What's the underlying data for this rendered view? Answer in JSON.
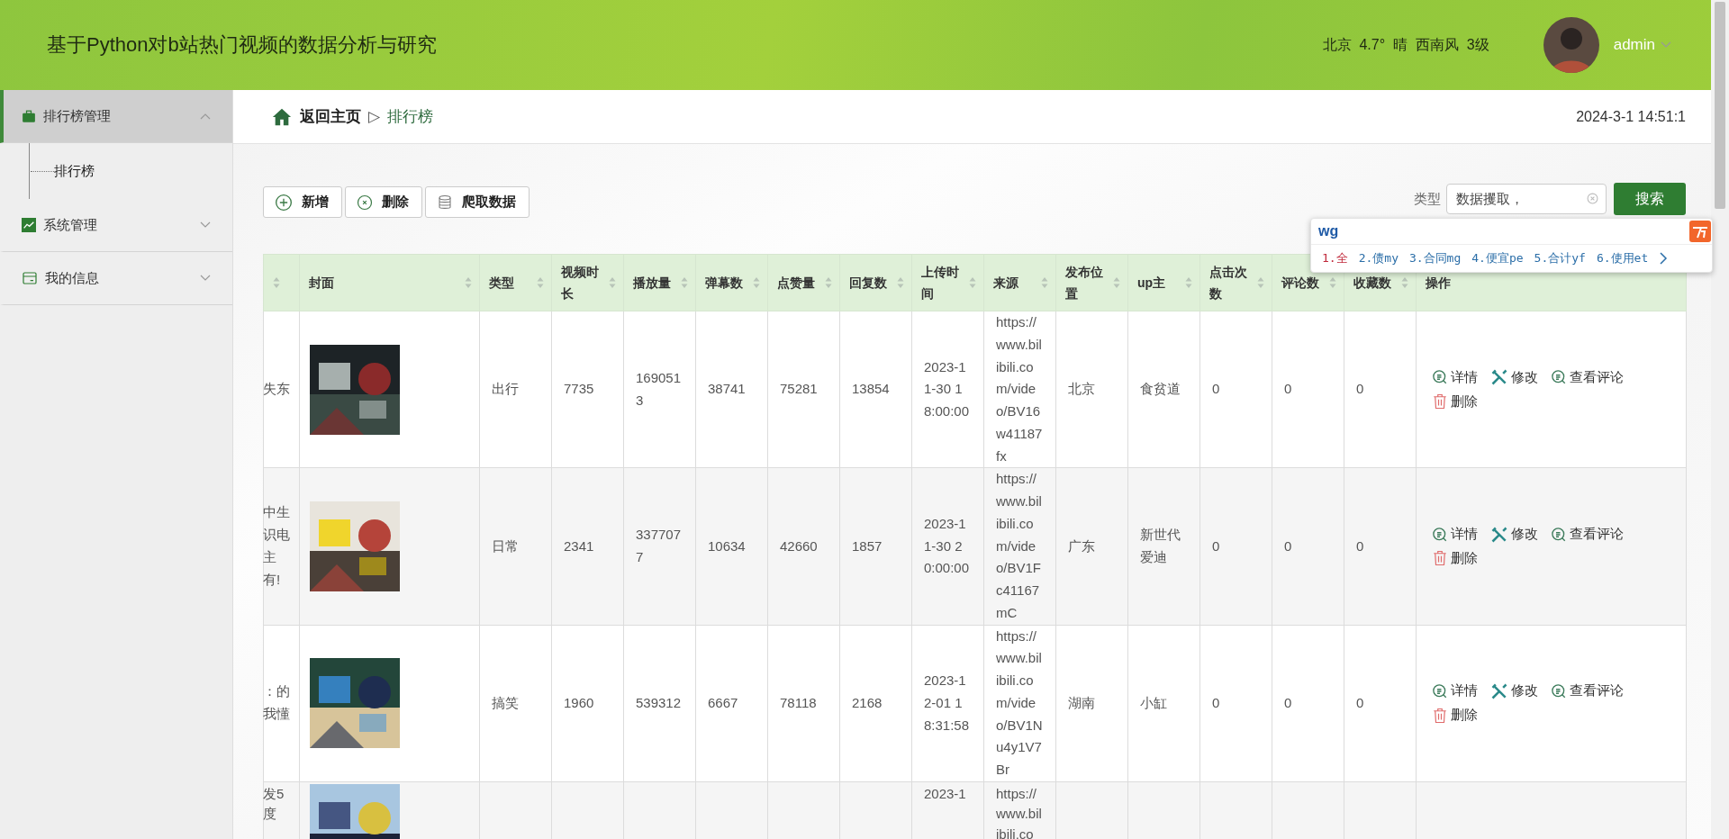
{
  "header": {
    "title": "基于Python对b站热门视频的数据分析与研究",
    "weather": "北京  4.7°  晴  西南风  3级",
    "user": "admin"
  },
  "sidebar": {
    "items": [
      {
        "label": "排行榜管理",
        "selected": true,
        "expanded": true,
        "children": [
          {
            "label": "排行榜",
            "selected": false
          }
        ]
      },
      {
        "label": "系统管理",
        "selected": false,
        "expanded": false
      },
      {
        "label": "我的信息",
        "selected": false,
        "expanded": false
      }
    ]
  },
  "breadcrumb": {
    "home": "返回主页",
    "separator": "▷",
    "current": "排行榜",
    "datetime": "2024-3-1 14:51:1"
  },
  "toolbar": {
    "buttons": [
      {
        "label": "新增",
        "kind": "add"
      },
      {
        "label": "删除",
        "kind": "remove"
      },
      {
        "label": "爬取数据",
        "kind": "crawl"
      }
    ]
  },
  "search": {
    "label": "类型",
    "value": "数据攫取，",
    "button": "搜索"
  },
  "ime_popup": {
    "input": "wg",
    "candidates": [
      {
        "label": "1.全",
        "selected": true
      },
      {
        "label": "2.债my",
        "selected": false
      },
      {
        "label": "3.合同mg",
        "selected": false
      },
      {
        "label": "4.便宜pe",
        "selected": false
      },
      {
        "label": "5.合计yf",
        "selected": false
      },
      {
        "label": "6.使用et",
        "selected": false
      }
    ]
  },
  "table": {
    "columns": [
      "封面",
      "类型",
      "视频时长",
      "播放量",
      "弹幕数",
      "点赞量",
      "回复数",
      "上传时间",
      "来源",
      "发布位置",
      "up主",
      "点击次数",
      "评论数",
      "收藏数",
      "操作"
    ],
    "rows": [
      {
        "column_1": "失东",
        "type": "出行",
        "duration": "7735",
        "plays": "1690513",
        "danmaku": "38741",
        "likes": "75281",
        "replies": "13854",
        "upload_time": "2023-11-30 18:00:00",
        "source": "https://www.bilibili.com/video/BV16w41187fx",
        "location": "北京",
        "uploader": "食贫道",
        "clicks": "0",
        "comments": "0",
        "favorites": "0",
        "actions": [
          {
            "label": "详情",
            "kind": "detail"
          },
          {
            "label": "修改",
            "kind": "edit"
          },
          {
            "label": "查看评论",
            "kind": "comments"
          },
          {
            "label": "删除",
            "kind": "delete"
          }
        ]
      },
      {
        "column_1": "中生识电主有!",
        "type": "日常",
        "duration": "2341",
        "plays": "3377077",
        "danmaku": "10634",
        "likes": "42660",
        "replies": "1857",
        "upload_time": "2023-11-30 20:00:00",
        "source": "https://www.bilibili.com/video/BV1Fc41167mC",
        "location": "广东",
        "uploader": "新世代爱迪",
        "clicks": "0",
        "comments": "0",
        "favorites": "0",
        "actions": [
          {
            "label": "详情",
            "kind": "detail"
          },
          {
            "label": "修改",
            "kind": "edit"
          },
          {
            "label": "查看评论",
            "kind": "comments"
          },
          {
            "label": "删除",
            "kind": "delete"
          }
        ]
      },
      {
        "column_1": "：的我懂",
        "type": "搞笑",
        "duration": "1960",
        "plays": "539312",
        "danmaku": "6667",
        "likes": "78118",
        "replies": "2168",
        "upload_time": "2023-12-01 18:31:58",
        "source": "https://www.bilibili.com/video/BV1Nu4y1V7Br",
        "location": "湖南",
        "uploader": "小缸",
        "clicks": "0",
        "comments": "0",
        "favorites": "0",
        "actions": [
          {
            "label": "详情",
            "kind": "detail"
          },
          {
            "label": "修改",
            "kind": "edit"
          },
          {
            "label": "查看评论",
            "kind": "comments"
          },
          {
            "label": "删除",
            "kind": "delete"
          }
        ]
      },
      {
        "column_1": "发5度",
        "upload_time": "2023-1",
        "source": "https://www.bilibili.co"
      }
    ]
  }
}
